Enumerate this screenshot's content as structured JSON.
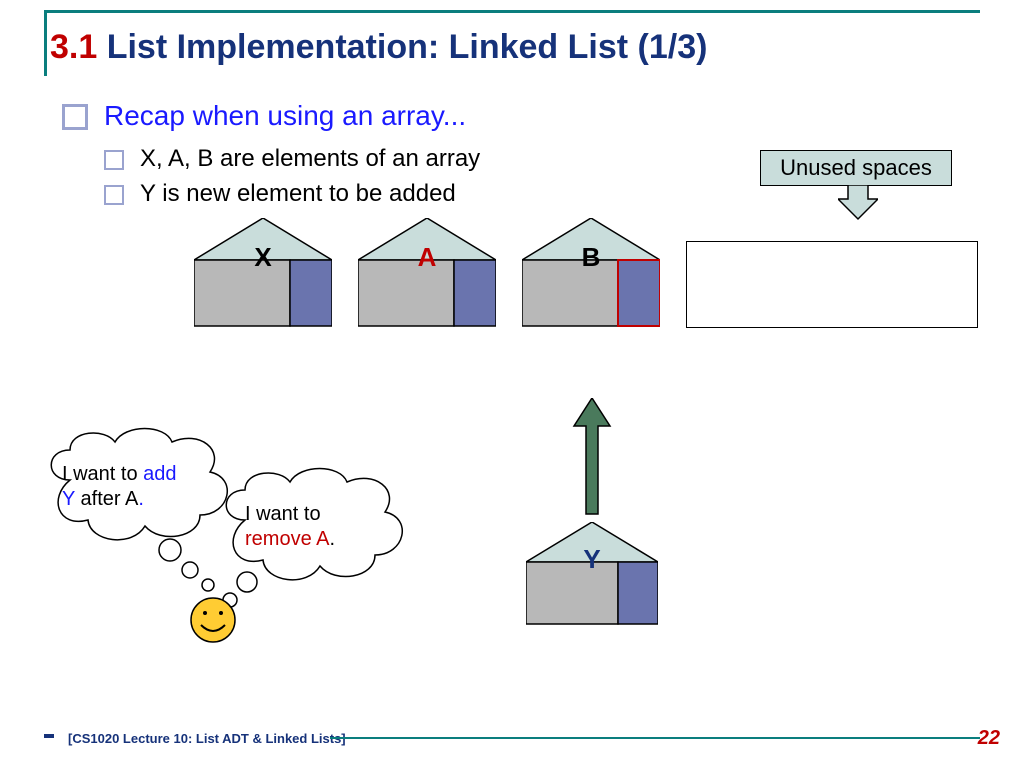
{
  "title": {
    "section": "3.1",
    "rest": " List Implementation: Linked List (1/3)"
  },
  "bullets": {
    "b1": "Recap when using an array...",
    "b2": "X, A, B are elements of an array",
    "b3": "Y is new element to be added"
  },
  "unused_label": "Unused spaces",
  "houses": {
    "x": "X",
    "a": "A",
    "b": "B",
    "y": "Y"
  },
  "thoughts": {
    "t1_pre": "I want to ",
    "t1_add": "add",
    "t1_mid": " Y",
    "t1_post": " after A",
    "t1_dot": ".",
    "t2_pre": "I want to ",
    "t2_rem": "remove A",
    "t2_dot": "."
  },
  "footer": "[CS1020 Lecture 10: List ADT & Linked Lists]",
  "page": "22"
}
